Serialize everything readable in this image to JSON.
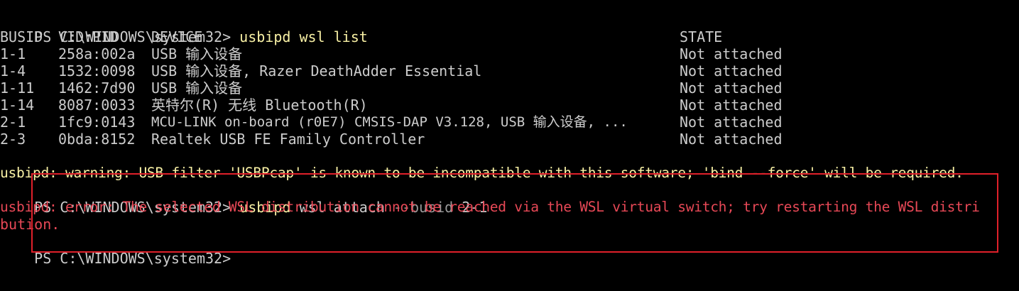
{
  "colors": {
    "background": "#000000",
    "text": "#cccccc",
    "command": "#f9f1a5",
    "warning": "#f9f1a5",
    "error": "#e74856",
    "highlight_border": "#e0202a"
  },
  "session": {
    "prompt": "PS C:\\WINDOWS\\system32> ",
    "command1": "usbipd wsl list",
    "table": {
      "headers": [
        "BUSID",
        "VID:PID",
        "DEVICE",
        "STATE"
      ],
      "rows": [
        [
          "1-1",
          "258a:002a",
          "USB 输入设备",
          "Not attached"
        ],
        [
          "1-4",
          "1532:0098",
          "USB 输入设备, Razer DeathAdder Essential",
          "Not attached"
        ],
        [
          "1-11",
          "1462:7d90",
          "USB 输入设备",
          "Not attached"
        ],
        [
          "1-14",
          "8087:0033",
          "英特尔(R) 无线 Bluetooth(R)",
          "Not attached"
        ],
        [
          "2-1",
          "1fc9:0143",
          "MCU-LINK on-board (r0E7) CMSIS-DAP V3.128, USB 输入设备, ...",
          "Not attached"
        ],
        [
          "2-3",
          "0bda:8152",
          "Realtek USB FE Family Controller",
          "Not attached"
        ]
      ]
    },
    "warning": "usbipd: warning: USB filter 'USBPcap' is known to be incompatible with this software; 'bind --force' will be required.",
    "command2_cmd": "usbipd",
    "command2_sub": " wsl attach ",
    "command2_flag": "--busid",
    "command2_val": " 2-1",
    "error_line1": "usbipd: error: The selected WSL distribution cannot be reached via the WSL virtual switch; try restarting the WSL distri",
    "error_line2": "bution.",
    "final_prompt": "PS C:\\WINDOWS\\system32>"
  }
}
